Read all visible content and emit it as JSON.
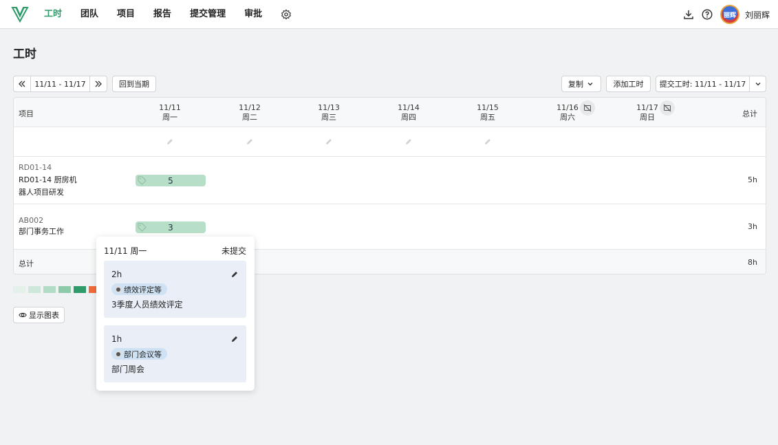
{
  "nav": {
    "items": [
      "工时",
      "团队",
      "项目",
      "报告",
      "提交管理",
      "审批"
    ],
    "active_index": 0,
    "accent_color": "#2f9a6a"
  },
  "user": {
    "name": "刘丽辉",
    "avatar_text": "丽辉"
  },
  "page": {
    "title": "工时"
  },
  "toolbar": {
    "date_range": "11/11 - 11/17",
    "back_to_current": "回到当期",
    "copy": "复制",
    "add_hours": "添加工时",
    "submit": "提交工时: 11/11 - 11/17"
  },
  "table": {
    "project_header": "项目",
    "total_header": "总计",
    "days": [
      {
        "date": "11/11",
        "weekday": "周一"
      },
      {
        "date": "11/12",
        "weekday": "周二"
      },
      {
        "date": "11/13",
        "weekday": "周三"
      },
      {
        "date": "11/14",
        "weekday": "周四"
      },
      {
        "date": "11/15",
        "weekday": "周五"
      },
      {
        "date": "11/16",
        "weekday": "周六"
      },
      {
        "date": "11/17",
        "weekday": "周日"
      }
    ],
    "projects": [
      {
        "code": "RD01-14",
        "name": "RD01-14 厨房机器人项目研发",
        "monday_hours": "5",
        "total": "5h"
      },
      {
        "code": "AB002",
        "name": "部门事务工作",
        "monday_hours": "3",
        "total": "3h"
      }
    ],
    "total_label": "总计",
    "grand_total": "8h"
  },
  "legend_colors": [
    "#e3f1ea",
    "#cde8da",
    "#b3dcc6",
    "#8ccaa9",
    "#2f9a6a",
    "#f26b3a"
  ],
  "show_chart": "显示图表",
  "popover": {
    "date": "11/11 周一",
    "status": "未提交",
    "entries": [
      {
        "hours": "2h",
        "tag": "绩效评定等",
        "description": "3季度人员绩效评定"
      },
      {
        "hours": "1h",
        "tag": "部门会议等",
        "description": "部门周会"
      }
    ]
  }
}
